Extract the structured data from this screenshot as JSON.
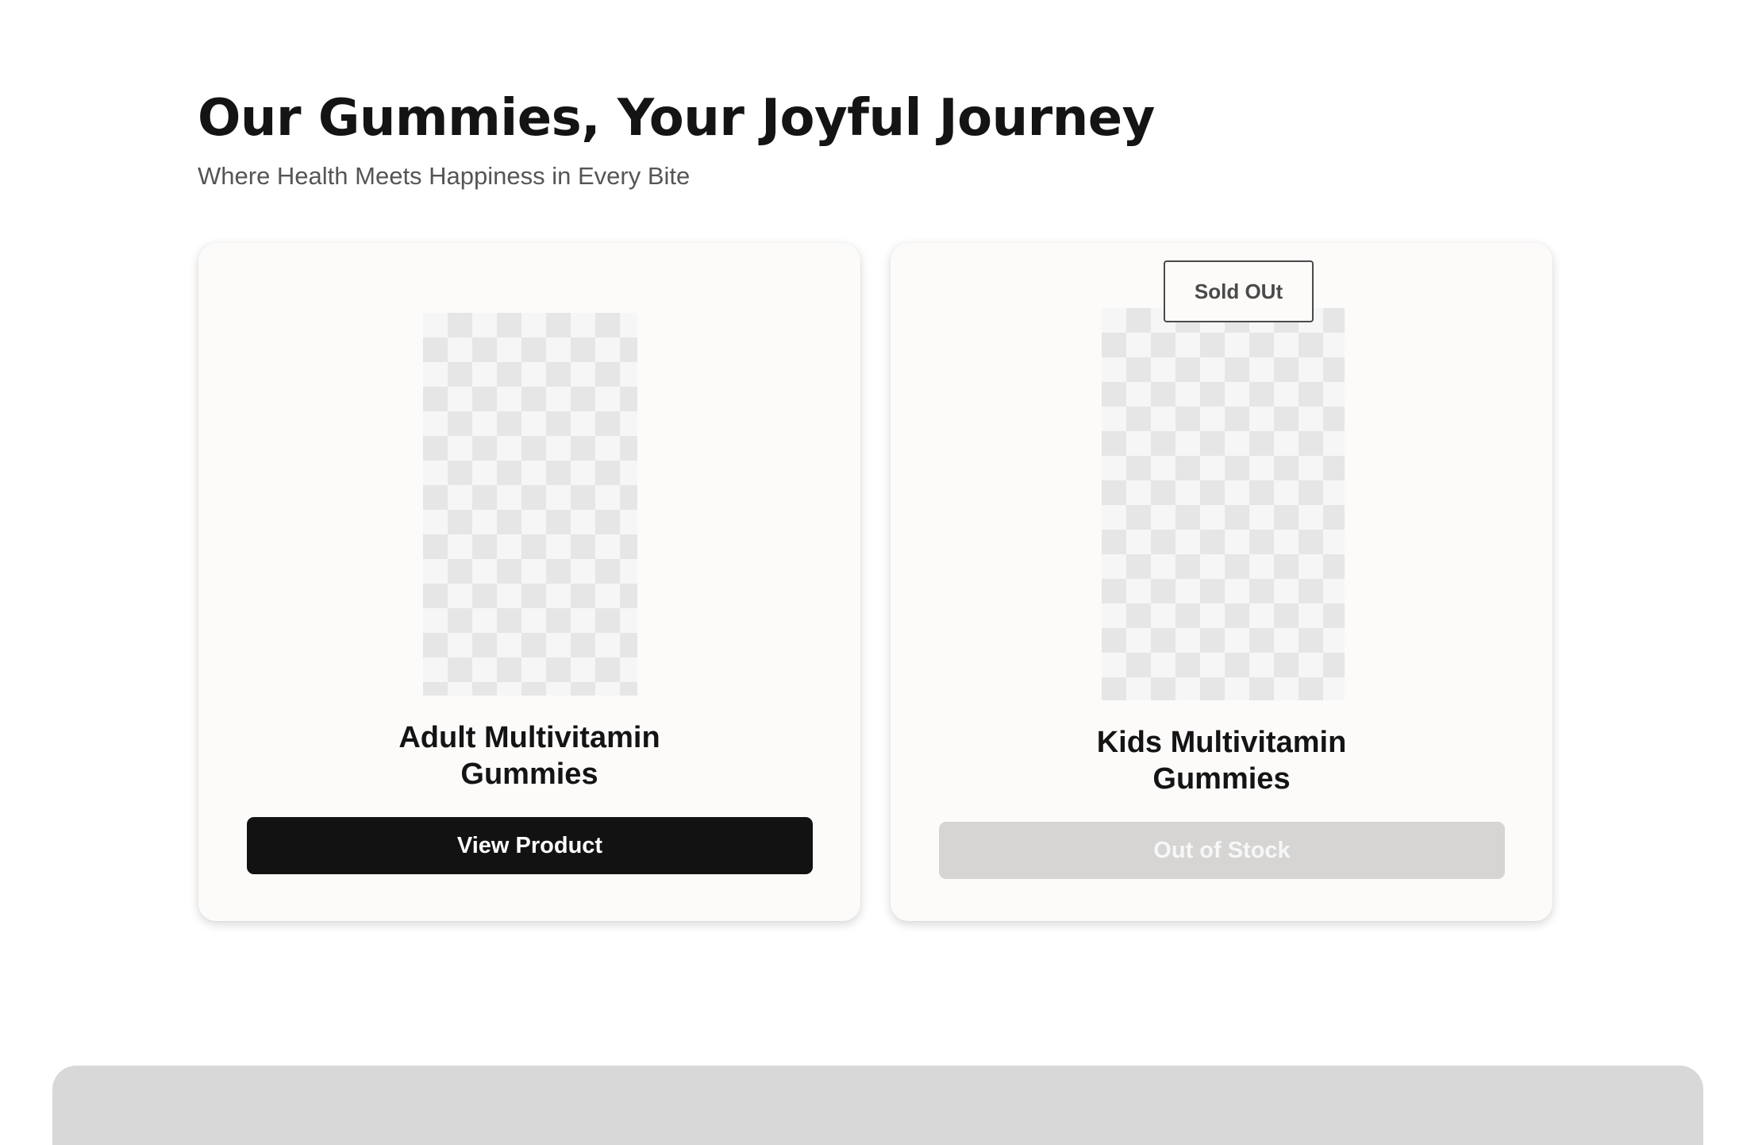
{
  "section": {
    "title": "Our Gummies, Your Joyful Journey",
    "subtitle": "Where Health Meets Happiness in Every Bite"
  },
  "products": [
    {
      "name_line1": "Adult Multivitamin",
      "name_line2": "Gummies",
      "button_label": "View Product",
      "status": "available"
    },
    {
      "badge": "Sold OUt",
      "name_line1": "Kids Multivitamin",
      "name_line2": "Gummies",
      "button_label": "Out of Stock",
      "status": "sold-out"
    }
  ],
  "colors": {
    "primary_button": "#121212",
    "disabled_button": "#d6d5d4",
    "card_background": "#fcfbfa",
    "footer_band": "#d8d8d8"
  }
}
